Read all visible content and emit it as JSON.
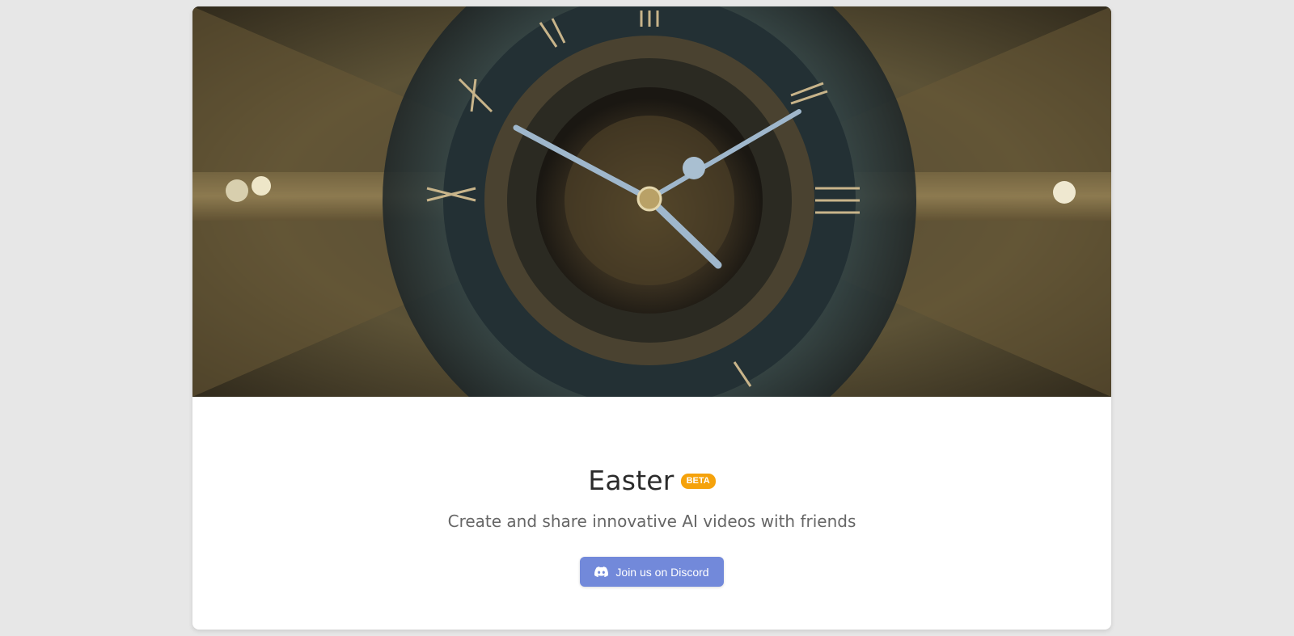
{
  "hero": {
    "image_description_icon": "clock-face-image"
  },
  "app": {
    "title": "Easter",
    "badge": "BETA",
    "tagline": "Create and share innovative AI videos with friends"
  },
  "cta": {
    "label": "Join us on Discord",
    "icon": "discord-icon"
  },
  "colors": {
    "page_bg": "#e7e7e7",
    "badge": "#f5a20b",
    "discord": "#7289da"
  }
}
